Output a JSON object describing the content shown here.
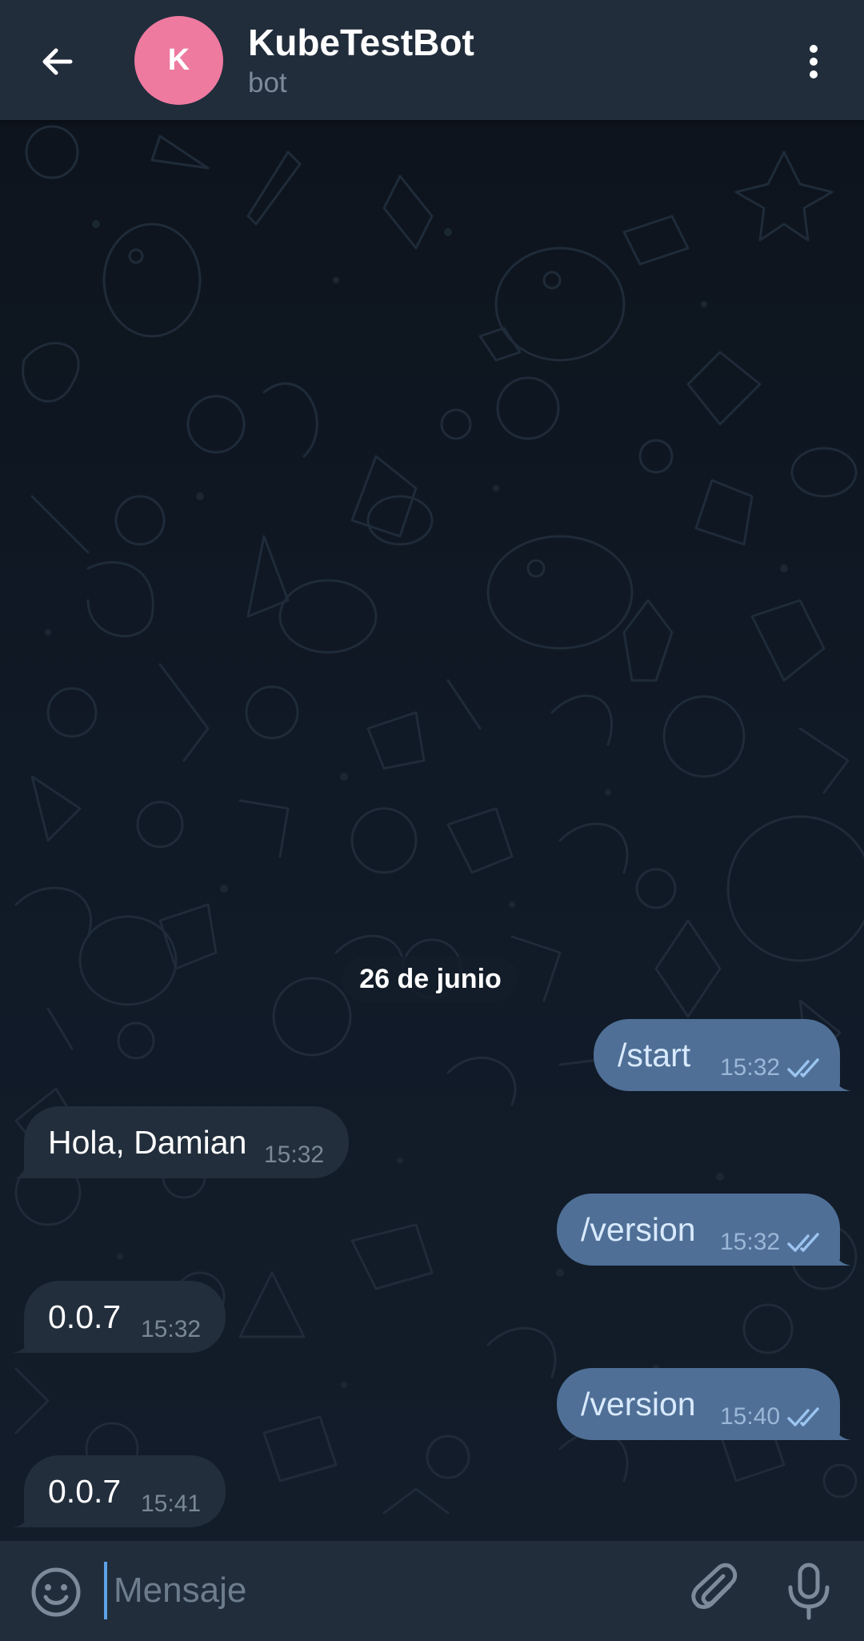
{
  "header": {
    "back_icon": "arrow-left-icon",
    "avatar_letter": "K",
    "avatar_color": "#ee7aa0",
    "title": "KubeTestBot",
    "subtitle": "bot",
    "menu_icon": "more-vertical-icon"
  },
  "chat": {
    "date_separator": "26 de junio",
    "messages": [
      {
        "direction": "outgoing",
        "text": "/start",
        "time": "15:32",
        "read": true
      },
      {
        "direction": "incoming",
        "text": "Hola, Damian",
        "time": "15:32"
      },
      {
        "direction": "outgoing",
        "text": "/version",
        "time": "15:32",
        "read": true
      },
      {
        "direction": "incoming",
        "text": "0.0.7",
        "time": "15:32"
      },
      {
        "direction": "outgoing",
        "text": "/version",
        "time": "15:40",
        "read": true
      },
      {
        "direction": "incoming",
        "text": "0.0.7",
        "time": "15:41"
      }
    ]
  },
  "input": {
    "placeholder": "Mensaje",
    "value": "",
    "emoji_icon": "emoji-icon",
    "attach_icon": "paperclip-icon",
    "mic_icon": "microphone-icon"
  },
  "colors": {
    "header_bg": "#212d3b",
    "chat_bg": "#0e1621",
    "outgoing_bubble": "#4f6f96",
    "incoming_bubble": "#222e3c",
    "accent": "#5ea1e6"
  }
}
